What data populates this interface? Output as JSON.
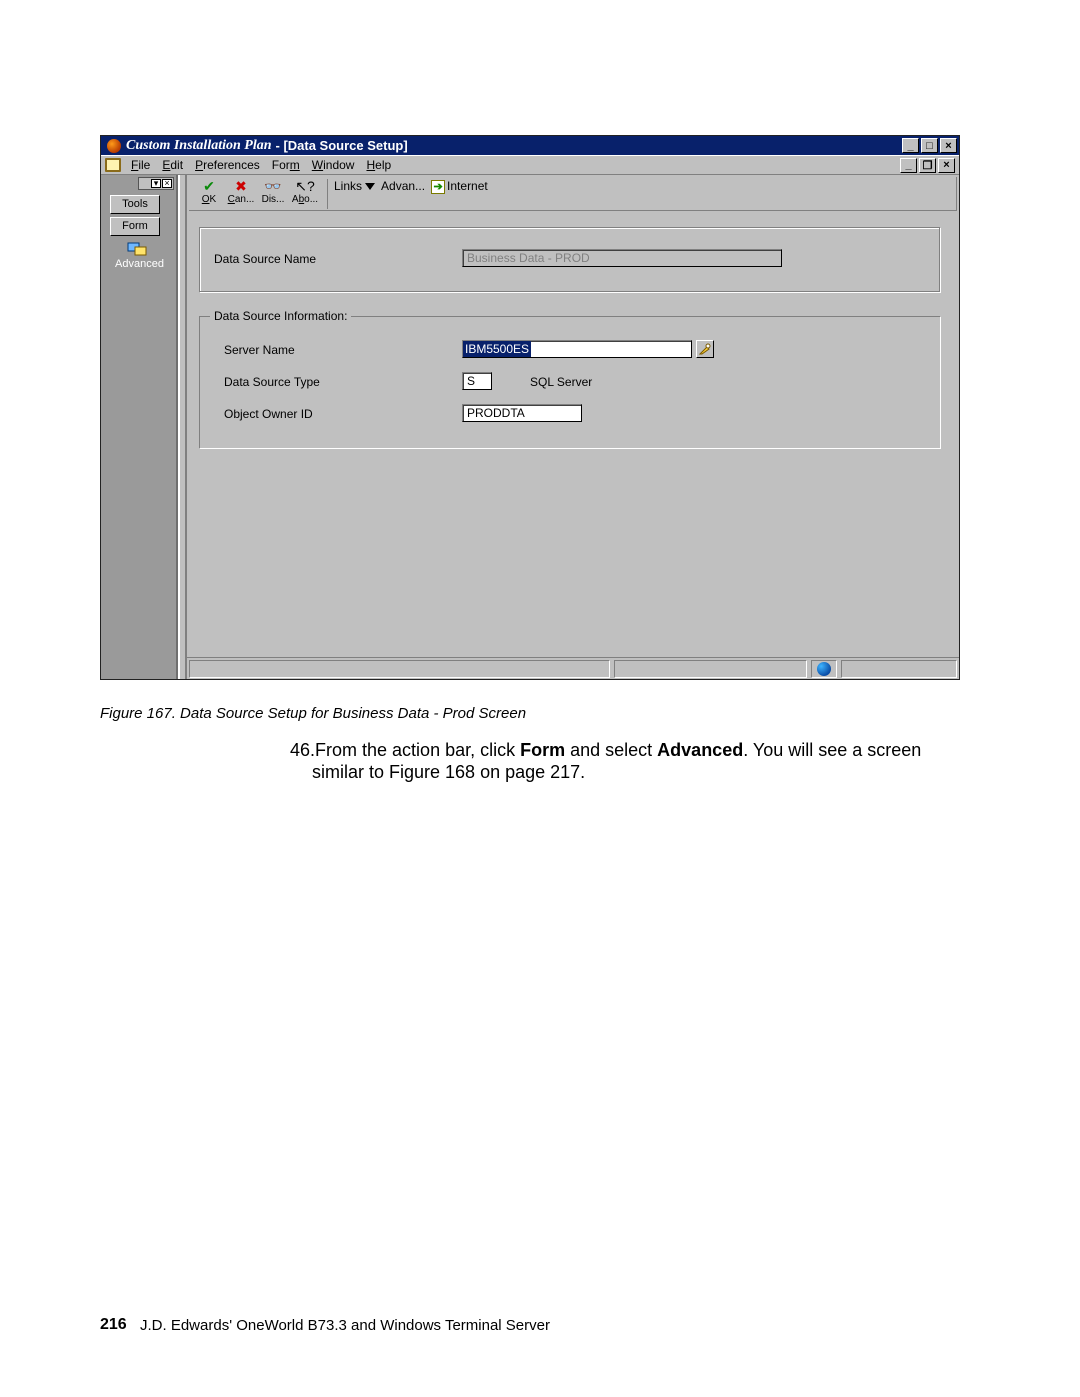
{
  "window": {
    "app_title": "Custom Installation Plan",
    "sub_title": " - [Data Source Setup]"
  },
  "menu": {
    "file": "File",
    "edit": "Edit",
    "preferences": "Preferences",
    "form": "Form",
    "window": "Window",
    "help": "Help"
  },
  "left": {
    "tools": "Tools",
    "form": "Form",
    "advanced": "Advanced"
  },
  "toolbar": {
    "ok": "OK",
    "cancel": "Can...",
    "display": "Dis...",
    "about": "Abo...",
    "links": "Links",
    "advan": "Advan...",
    "internet": "Internet"
  },
  "form": {
    "ds_name_label": "Data Source Name",
    "ds_name_value": "Business Data - PROD",
    "group_title": "Data Source Information:",
    "server_label": "Server Name",
    "server_value": "IBM5500ES",
    "type_label": "Data Source Type",
    "type_code": "S",
    "type_text": "SQL Server",
    "owner_label": "Object Owner ID",
    "owner_value": "PRODDTA"
  },
  "figure": {
    "caption": "Figure 167.  Data Source Setup for Business Data - Prod Screen",
    "step_num": "46.",
    "line1a": "From the action bar, click ",
    "line1b": "Form",
    "line1c": " and select ",
    "line1d": "Advanced",
    "line1e": ". You will see a screen",
    "line2": "similar to Figure 168 on page 217."
  },
  "footer": {
    "page": "216",
    "text": "J.D. Edwards' OneWorld B73.3 and Windows Terminal Server"
  }
}
